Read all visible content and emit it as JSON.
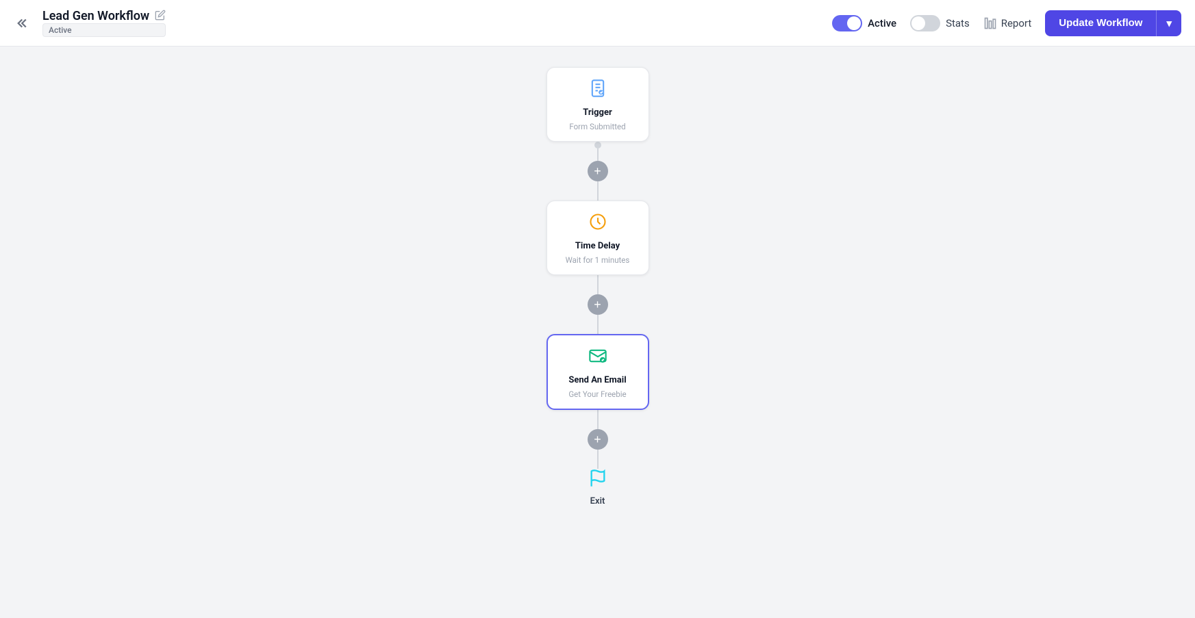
{
  "header": {
    "back_label": "<<",
    "workflow_name": "Lead Gen Workflow",
    "workflow_status_badge": "Active",
    "edit_icon": "✏",
    "active_toggle": true,
    "active_label": "Active",
    "stats_label": "Stats",
    "report_label": "Report",
    "update_btn_label": "Update Workflow",
    "update_btn_chevron": "▾"
  },
  "workflow": {
    "nodes": [
      {
        "id": "trigger",
        "type": "trigger",
        "icon": "📋",
        "icon_color": "#60a5fa",
        "title": "Trigger",
        "subtitle": "Form Submitted",
        "selected": false
      },
      {
        "id": "time-delay",
        "type": "delay",
        "icon": "🕐",
        "icon_color": "#f59e0b",
        "title": "Time Delay",
        "subtitle": "Wait for 1 minutes",
        "selected": false
      },
      {
        "id": "send-email",
        "type": "email",
        "icon": "✉",
        "icon_color": "#10b981",
        "title": "Send An Email",
        "subtitle": "Get Your Freebie",
        "selected": true
      }
    ],
    "exit_label": "Exit"
  }
}
